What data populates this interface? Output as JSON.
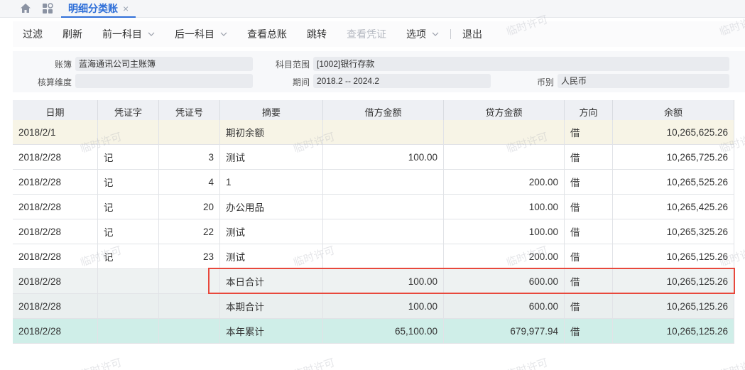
{
  "tabbar": {
    "home_icon": "home-icon",
    "apps_icon": "apps-icon",
    "active_tab": {
      "label": "明细分类账",
      "close": "×"
    }
  },
  "toolbar": {
    "filter": "过滤",
    "refresh": "刷新",
    "prev_account": "前一科目",
    "next_account": "后一科目",
    "view_ledger": "查看总账",
    "jump": "跳转",
    "view_voucher": "查看凭证",
    "options": "选项",
    "exit": "退出"
  },
  "filter": {
    "book_label": "账簿",
    "book_value": "蓝海通讯公司主账簿",
    "subject_range_label": "科目范围",
    "subject_range_value": "[1002]银行存款",
    "dimension_label": "核算维度",
    "dimension_value": "",
    "period_label": "期间",
    "period_value": "2018.2 -- 2024.2",
    "currency_label": "币别",
    "currency_value": "人民币"
  },
  "table": {
    "headers": [
      "日期",
      "凭证字",
      "凭证号",
      "摘要",
      "借方金额",
      "贷方金额",
      "方向",
      "余额"
    ],
    "rows": [
      {
        "type": "opening",
        "date": "2018/2/1",
        "word": "",
        "no": "",
        "summary": "期初余额",
        "debit": "",
        "credit": "",
        "direction": "借",
        "balance": "10,265,625.26"
      },
      {
        "type": "normal",
        "date": "2018/2/28",
        "word": "记",
        "no": "3",
        "summary": "测试",
        "debit": "100.00",
        "credit": "",
        "direction": "借",
        "balance": "10,265,725.26"
      },
      {
        "type": "normal",
        "date": "2018/2/28",
        "word": "记",
        "no": "4",
        "summary": "1",
        "debit": "",
        "credit": "200.00",
        "direction": "借",
        "balance": "10,265,525.26"
      },
      {
        "type": "normal",
        "date": "2018/2/28",
        "word": "记",
        "no": "20",
        "summary": "办公用品",
        "debit": "",
        "credit": "100.00",
        "direction": "借",
        "balance": "10,265,425.26"
      },
      {
        "type": "normal",
        "date": "2018/2/28",
        "word": "记",
        "no": "22",
        "summary": "测试",
        "debit": "",
        "credit": "100.00",
        "direction": "借",
        "balance": "10,265,325.26"
      },
      {
        "type": "normal",
        "date": "2018/2/28",
        "word": "记",
        "no": "23",
        "summary": "测试",
        "debit": "",
        "credit": "200.00",
        "direction": "借",
        "balance": "10,265,125.26"
      },
      {
        "type": "dayTotal",
        "date": "2018/2/28",
        "word": "",
        "no": "",
        "summary": "本日合计",
        "debit": "100.00",
        "credit": "600.00",
        "direction": "借",
        "balance": "10,265,125.26"
      },
      {
        "type": "periodTotal",
        "date": "2018/2/28",
        "word": "",
        "no": "",
        "summary": "本期合计",
        "debit": "100.00",
        "credit": "600.00",
        "direction": "借",
        "balance": "10,265,125.26"
      },
      {
        "type": "yearTotal",
        "date": "2018/2/28",
        "word": "",
        "no": "",
        "summary": "本年累计",
        "debit": "65,100.00",
        "credit": "679,977.94",
        "direction": "借",
        "balance": "10,265,125.26"
      }
    ]
  },
  "watermark": "临时许可",
  "colors": {
    "accent": "#2f6fd8",
    "highlight": "#e8483c",
    "opening_row": "#f7f4e6",
    "year_total_row": "#cfeee8"
  }
}
